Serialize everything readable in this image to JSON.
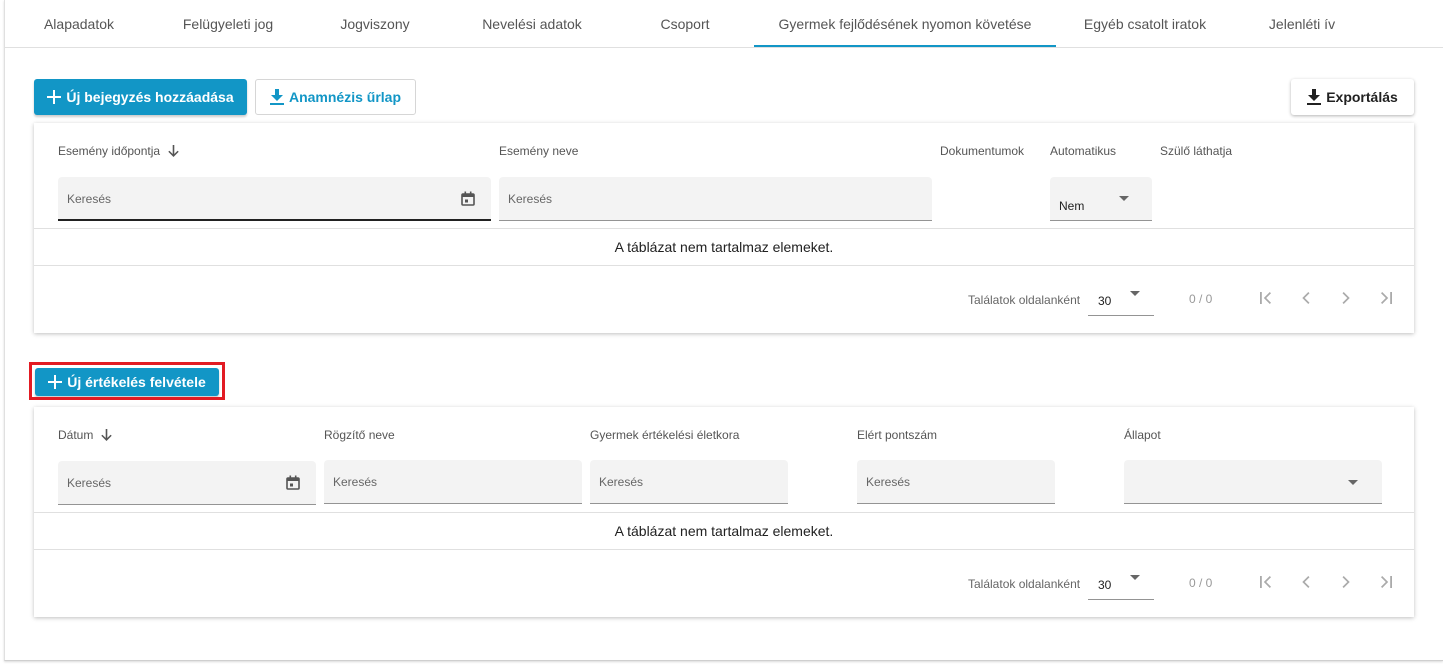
{
  "tabs": [
    {
      "label": "Alapadatok"
    },
    {
      "label": "Felügyeleti jog"
    },
    {
      "label": "Jogviszony"
    },
    {
      "label": "Nevelési adatok"
    },
    {
      "label": "Csoport"
    },
    {
      "label": "Gyermek fejlődésének nyomon követése",
      "active": true
    },
    {
      "label": "Egyéb csatolt iratok"
    },
    {
      "label": "Jelenléti ív"
    }
  ],
  "toolbar": {
    "new_entry_label": "Új bejegyzés hozzáadása",
    "anamnesis_label": "Anamnézis űrlap",
    "export_label": "Exportálás"
  },
  "events_table": {
    "columns": [
      "Esemény időpontja",
      "Esemény neve",
      "Dokumentumok",
      "Automatikus",
      "Szülő láthatja"
    ],
    "search_placeholder": "Keresés",
    "auto_filter_value": "Nem",
    "empty_text": "A táblázat nem tartalmaz elemeket.",
    "per_page_label": "Találatok oldalanként",
    "per_page_value": "30",
    "range_text": "0 / 0"
  },
  "evaluation": {
    "new_label": "Új értékelés felvétele"
  },
  "eval_table": {
    "columns": [
      "Dátum",
      "Rögzítő neve",
      "Gyermek értékelési életkora",
      "Elért pontszám",
      "Állapot"
    ],
    "search_placeholder": "Keresés",
    "empty_text": "A táblázat nem tartalmaz elemeket.",
    "per_page_label": "Találatok oldalanként",
    "per_page_value": "30",
    "range_text": "0 / 0"
  },
  "colors": {
    "accent": "#1296c6",
    "highlight": "#e21b23"
  },
  "icons": [
    "plus-icon",
    "download-icon",
    "calendar-icon",
    "arrow-down-icon",
    "first-page-icon",
    "chevron-left-icon",
    "chevron-right-icon",
    "last-page-icon"
  ]
}
